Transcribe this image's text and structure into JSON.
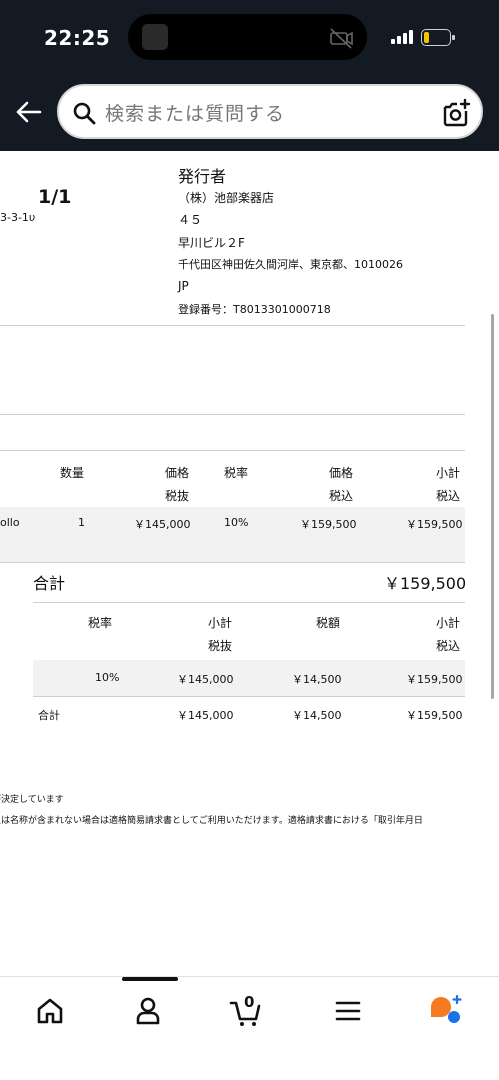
{
  "status_bar": {
    "time": "22:25"
  },
  "search": {
    "placeholder": "検索または質問する"
  },
  "issuer": {
    "heading": "発行者",
    "lines": [
      "（株）池部楽器店",
      "４５",
      "早川ビル２F",
      "千代田区神田佐久間河岸、東京都、1010026",
      "JP",
      "登録番号：T8013301000718"
    ]
  },
  "invoice": {
    "page": "1/1",
    "left_fragment": "3-3-1υ"
  },
  "items_table": {
    "headers": {
      "quantity": "数量",
      "price": "価格",
      "price_sub": "税抜",
      "tax_rate": "税率",
      "price_incl": "価格",
      "price_incl_sub": "税込",
      "subtotal": "小計",
      "subtotal_sub": "税込"
    },
    "rows": [
      {
        "name_fragment": "ollo",
        "quantity": "1",
        "price_excl": "￥145,000",
        "tax_rate": "10%",
        "price_incl": "￥159,500",
        "subtotal": "￥159,500"
      }
    ]
  },
  "total": {
    "label": "合計",
    "value": "￥159,500"
  },
  "tax_table": {
    "headers": {
      "tax_rate": "税率",
      "subtotal": "小計",
      "subtotal_sub": "税抜",
      "tax_amount": "税額",
      "subtotal_incl": "小計",
      "subtotal_incl_sub": "税込"
    },
    "rows": [
      {
        "tax_rate": "10%",
        "subtotal_excl": "￥145,000",
        "tax_amount": "￥14,500",
        "subtotal_incl": "￥159,500"
      }
    ],
    "total_row": {
      "label": "合計",
      "subtotal_excl": "￥145,000",
      "tax_amount": "￥14,500",
      "subtotal_incl": "￥159,500"
    }
  },
  "notes": [
    "が決定しています",
    "又は名称が含まれない場合は適格簡易請求書としてご利用いただけます。適格請求書における「取引年月日"
  ],
  "bottom_nav": {
    "cart_count": "0"
  },
  "colors": {
    "header_bg": "#131a24",
    "assistant_orange": "#f47b20",
    "assistant_blue": "#1a73e8"
  }
}
